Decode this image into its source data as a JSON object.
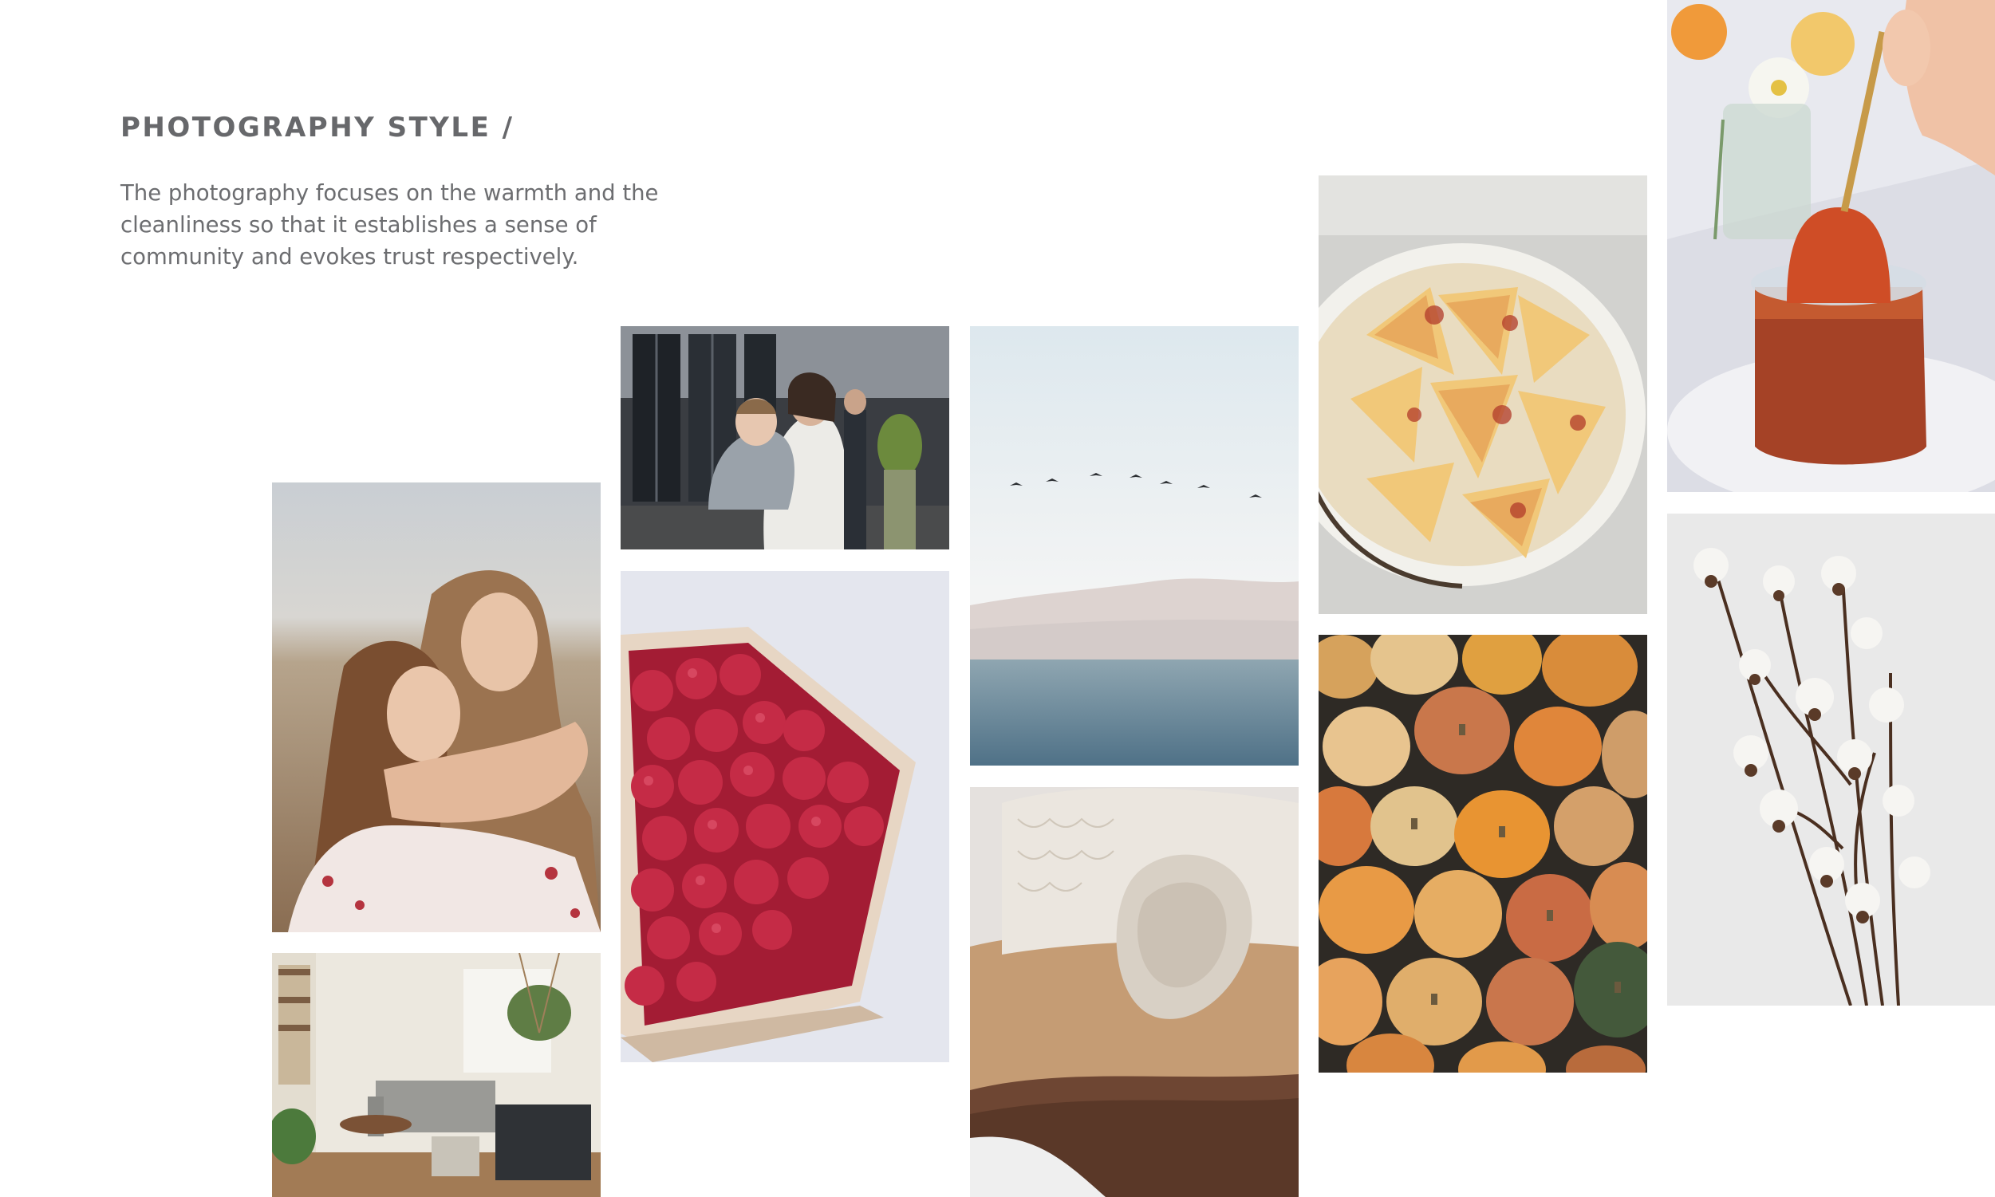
{
  "header": {
    "title": "PHOTOGRAPHY STYLE /",
    "description": "The photography focuses on the warmth and the cleanliness so that it establishes a sense of community and evokes trust respectively."
  },
  "colors": {
    "title": "#67686b",
    "body_text": "#6c6d70",
    "background": "#ffffff"
  },
  "photos": [
    {
      "subject": "two-women-hugging"
    },
    {
      "subject": "living-room-interior"
    },
    {
      "subject": "mother-and-child"
    },
    {
      "subject": "raspberries-in-basket"
    },
    {
      "subject": "birds-over-sea"
    },
    {
      "subject": "knit-sweaters"
    },
    {
      "subject": "sliced-peaches"
    },
    {
      "subject": "pumpkins"
    },
    {
      "subject": "jam-jar-with-spoon"
    },
    {
      "subject": "cotton-branches"
    }
  ]
}
